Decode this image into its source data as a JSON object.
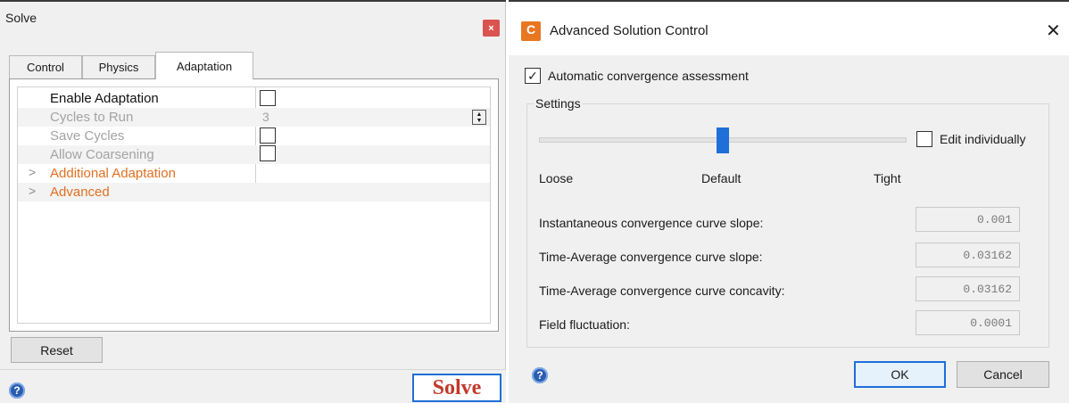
{
  "solve": {
    "title": "Solve",
    "close_glyph": "×",
    "tabs": [
      {
        "label": "Control",
        "active": false
      },
      {
        "label": "Physics",
        "active": false
      },
      {
        "label": "Adaptation",
        "active": true
      }
    ],
    "properties": [
      {
        "label": "Enable Adaptation",
        "checkbox": false
      },
      {
        "label": "Cycles to Run",
        "value": "3"
      },
      {
        "label": "Save Cycles",
        "checkbox": false
      },
      {
        "label": "Allow Coarsening",
        "checkbox": false
      },
      {
        "label": "Additional Adaptation",
        "expandable": true
      },
      {
        "label": "Advanced",
        "expandable": true
      }
    ],
    "chevron_glyph": ">",
    "reset_label": "Reset",
    "solve_label": "Solve",
    "help_glyph": "?"
  },
  "advanced": {
    "app_icon_letter": "C",
    "title": "Advanced Solution Control",
    "close_glyph": "✕",
    "auto_label": "Automatic convergence assessment",
    "auto_checked": true,
    "check_glyph": "✓",
    "settings_legend": "Settings",
    "slider": {
      "position": "Default",
      "labels": {
        "loose": "Loose",
        "default": "Default",
        "tight": "Tight"
      }
    },
    "edit_individually_label": "Edit individually",
    "edit_individually_checked": false,
    "criteria": [
      {
        "label": "Instantaneous convergence curve slope:",
        "value": "0.001"
      },
      {
        "label": "Time-Average convergence curve slope:",
        "value": "0.03162"
      },
      {
        "label": "Time-Average convergence curve concavity:",
        "value": "0.03162"
      },
      {
        "label": "Field fluctuation:",
        "value": "0.0001"
      }
    ],
    "ok_label": "OK",
    "cancel_label": "Cancel",
    "help_glyph": "?"
  },
  "colors": {
    "accent_blue": "#1e6fd9",
    "link_orange": "#e07020",
    "solve_red": "#c0392b",
    "app_icon_orange": "#e87722",
    "close_red": "#d9534f"
  }
}
